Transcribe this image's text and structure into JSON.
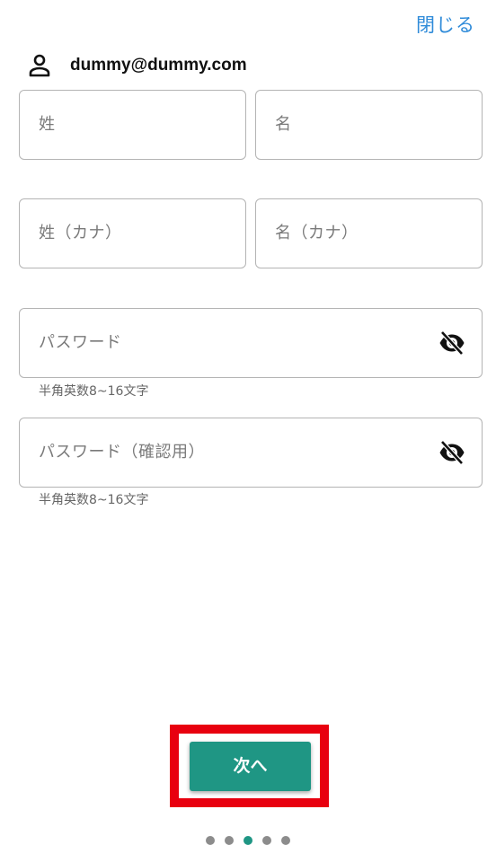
{
  "header": {
    "close_label": "閉じる",
    "account_email": "dummy@dummy.com",
    "account_icon": "person-icon"
  },
  "form": {
    "last_name_placeholder": "姓",
    "first_name_placeholder": "名",
    "last_name_kana_placeholder": "姓（カナ）",
    "first_name_kana_placeholder": "名（カナ）",
    "password_placeholder": "パスワード",
    "password_helper": "半角英数8~16文字",
    "password_confirm_placeholder": "パスワード（確認用）",
    "password_confirm_helper": "半角英数8~16文字",
    "visibility_icon": "eye-off-icon"
  },
  "footer": {
    "next_label": "次へ",
    "page_count": 5,
    "current_page": 3
  },
  "colors": {
    "accent": "#1f9684",
    "link": "#2f8bd9",
    "highlight": "#e8000f"
  }
}
